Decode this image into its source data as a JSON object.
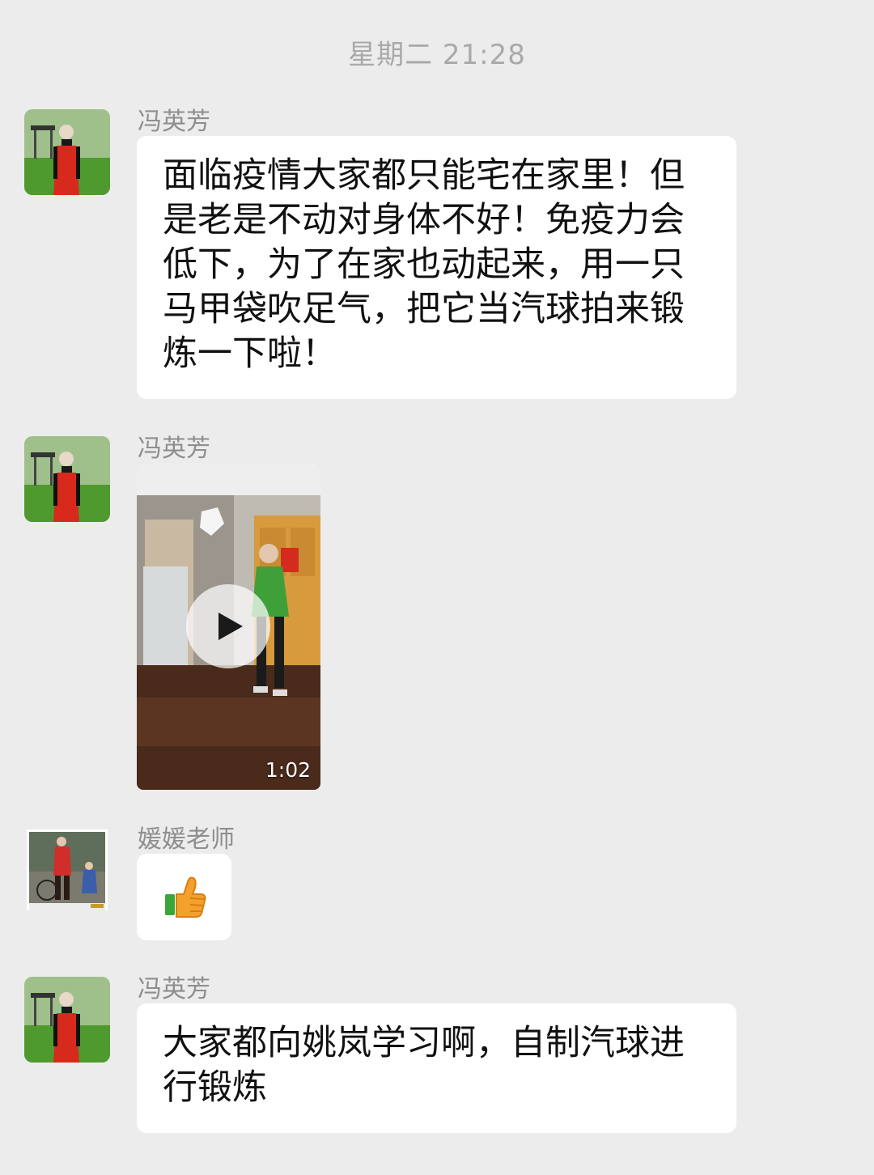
{
  "chat": {
    "timestamp": "星期二 21:28",
    "messages": [
      {
        "sender": "冯英芳",
        "type": "text",
        "text": "面临疫情大家都只能宅在家里！但是老是不动对身体不好！免疫力会低下，为了在家也动起来，用一只马甲袋吹足气，把它当汽球拍来锻炼一下啦！"
      },
      {
        "sender": "冯英芳",
        "type": "video",
        "duration": "1:02"
      },
      {
        "sender": "媛媛老师",
        "type": "emoji",
        "emoji": "thumbs-up-icon"
      },
      {
        "sender": "冯英芳",
        "type": "text",
        "text": "大家都向姚岚学习啊，自制汽球进行锻炼"
      }
    ]
  },
  "colors": {
    "background": "#ececec",
    "bubble": "#ffffff",
    "sender": "#8e8e8e",
    "timestamp": "#a9a9a9"
  }
}
